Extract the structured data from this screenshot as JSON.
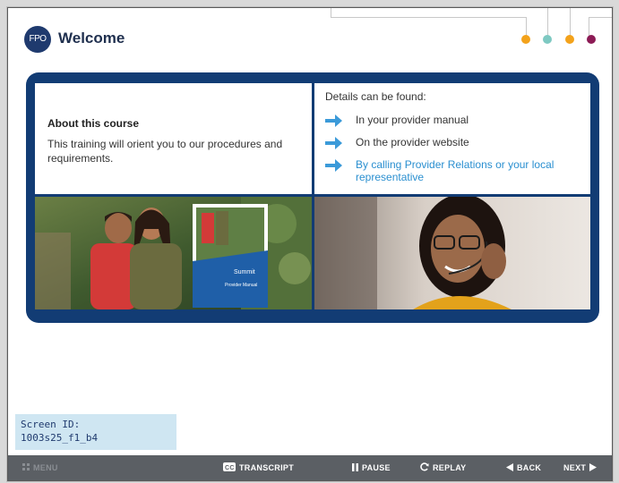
{
  "header": {
    "badge": "FPO",
    "title": "Welcome",
    "progress_dots": [
      "#f3a21b",
      "#7ec9c2",
      "#f3a21b",
      "#8c1b55"
    ]
  },
  "course": {
    "about_title": "About this course",
    "about_text": "This training will orient you to our procedures and requirements."
  },
  "details": {
    "heading": "Details can be found:",
    "items": [
      {
        "text": "In your provider manual",
        "link": false
      },
      {
        "text": "On the provider website",
        "link": false
      },
      {
        "text": "By calling Provider Relations or your local representative",
        "link": true
      }
    ],
    "arrow_color": "#3b9ad9"
  },
  "images": {
    "left_caption_brand": "Summit",
    "left_caption_manual": "Provider Manual"
  },
  "screen_id": {
    "label": "Screen ID:",
    "value": "1003s25_f1_b4"
  },
  "toolbar": {
    "menu": "MENU",
    "transcript": "TRANSCRIPT",
    "pause": "PAUSE",
    "replay": "REPLAY",
    "back": "BACK",
    "next": "NEXT"
  },
  "colors": {
    "navy": "#123c74",
    "toolbar": "#5b5f64",
    "link": "#2a8fd0"
  }
}
